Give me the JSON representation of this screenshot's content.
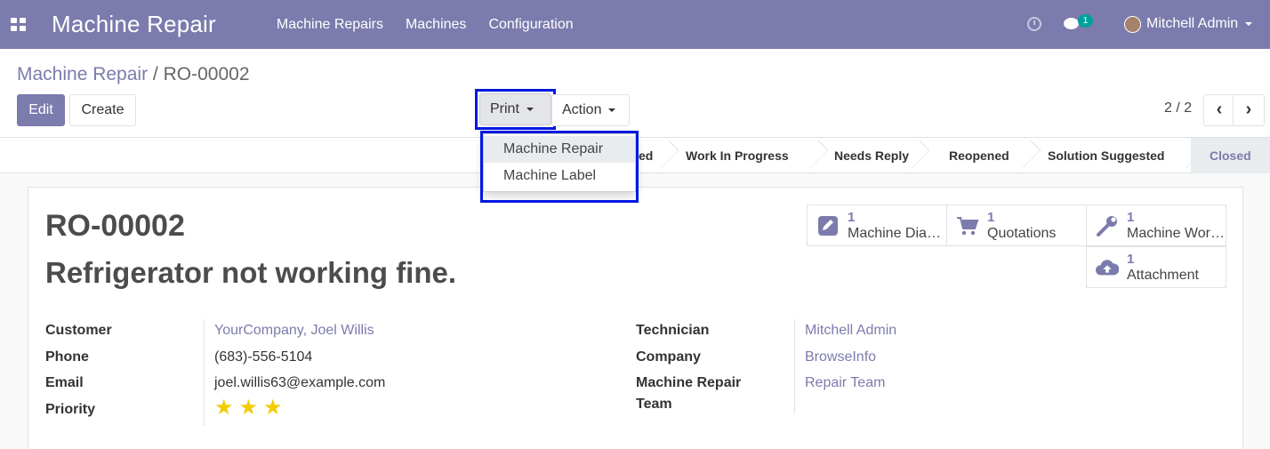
{
  "navbar": {
    "app_title": "Machine Repair",
    "menu": [
      "Machine Repairs",
      "Machines",
      "Configuration"
    ],
    "chat_badge": "1",
    "user_name": "Mitchell Admin",
    "bg_color": "#7c7bad"
  },
  "breadcrumb": {
    "parent": "Machine Repair",
    "separator": "/",
    "current": "RO-00002"
  },
  "buttons": {
    "edit": "Edit",
    "create": "Create",
    "print": "Print",
    "action": "Action"
  },
  "pager": {
    "value": "2 / 2",
    "prev_icon": "‹",
    "next_icon": "›"
  },
  "print_menu": {
    "items": [
      "Machine Repair",
      "Machine Label"
    ],
    "active_index": 0
  },
  "stages": {
    "partial_label": "ed",
    "items": [
      "Work In Progress",
      "Needs Reply",
      "Reopened",
      "Solution Suggested",
      "Closed"
    ],
    "current": "Closed"
  },
  "record": {
    "reference": "RO-00002",
    "title": "Refrigerator not working fine."
  },
  "smart_buttons": [
    {
      "count": "1",
      "label": "Machine Diagnosis",
      "icon": "pencil-square-icon"
    },
    {
      "count": "1",
      "label": "Quotations",
      "icon": "shopping-cart-icon"
    },
    {
      "count": "1",
      "label": "Machine Work Order",
      "icon": "wrench-icon"
    },
    {
      "count": "1",
      "label": "Attachment",
      "icon": "cloud-upload-icon"
    }
  ],
  "fields_left": {
    "customer_label": "Customer",
    "customer_value": "YourCompany, Joel Willis",
    "phone_label": "Phone",
    "phone_value": "(683)-556-5104",
    "email_label": "Email",
    "email_value": "joel.willis63@example.com",
    "priority_label": "Priority",
    "priority_stars": 3,
    "star_color": "#f3cc00"
  },
  "fields_right": {
    "technician_label": "Technician",
    "technician_value": "Mitchell Admin",
    "company_label": "Company",
    "company_value": "BrowseInfo",
    "team_label_1": "Machine Repair",
    "team_label_2": "Team",
    "team_value": "Repair Team"
  }
}
